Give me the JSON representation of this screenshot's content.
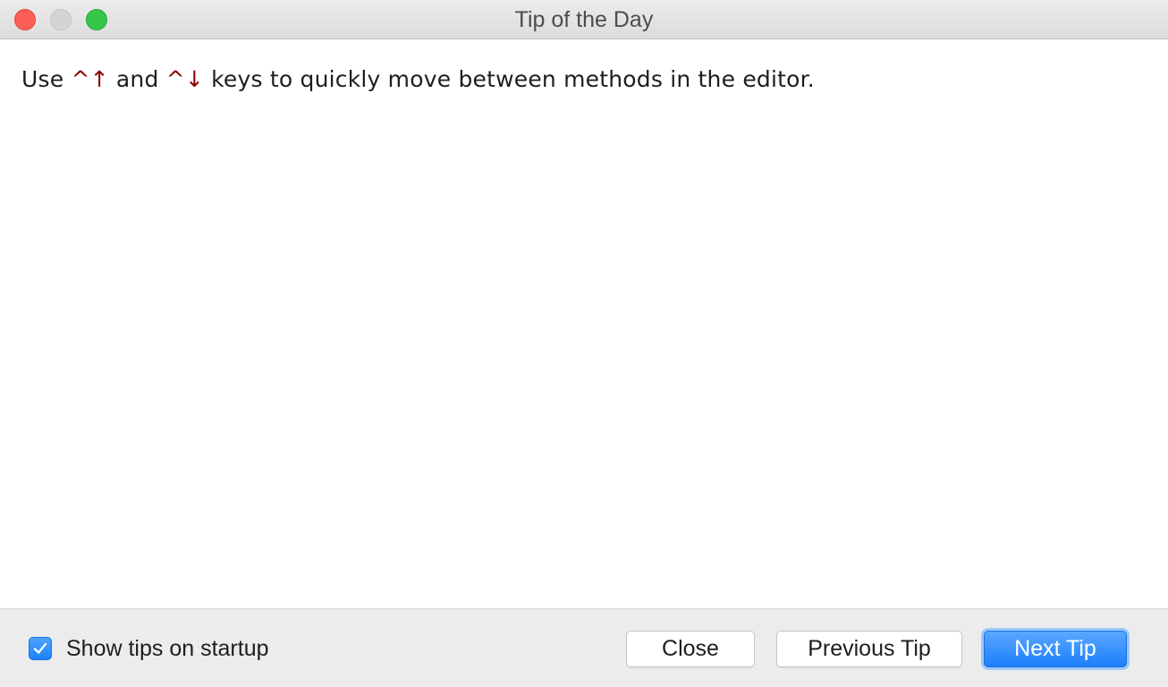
{
  "window": {
    "title": "Tip of the Day"
  },
  "tip": {
    "prefix": "Use ",
    "shortcut_up": "^↑",
    "middle": " and ",
    "shortcut_down": "^↓",
    "suffix": " keys to quickly move between methods in the editor."
  },
  "footer": {
    "show_tips_label": "Show tips on startup",
    "show_tips_checked": true,
    "close_label": "Close",
    "previous_label": "Previous Tip",
    "next_label": "Next Tip"
  },
  "colors": {
    "accent": "#1c7ffb",
    "shortcut": "#8b0000"
  },
  "icons": {
    "checkbox": "checkmark-icon"
  }
}
